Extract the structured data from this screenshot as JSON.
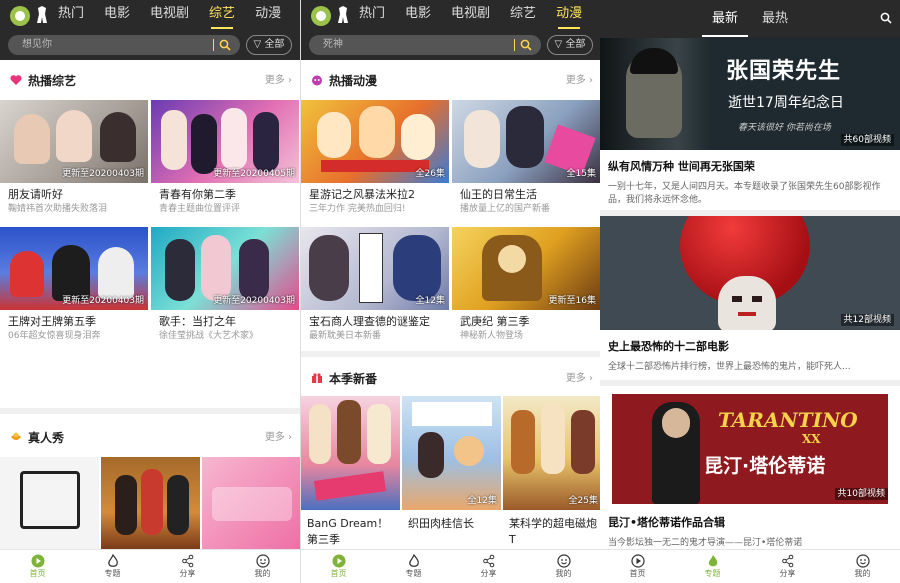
{
  "screen1": {
    "tabs": [
      {
        "label": "热门",
        "active": false
      },
      {
        "label": "电影",
        "active": false
      },
      {
        "label": "电视剧",
        "active": false
      },
      {
        "label": "综艺",
        "active": true
      },
      {
        "label": "动漫",
        "active": false
      }
    ],
    "search_placeholder": "想见你",
    "filter_label": "全部",
    "section1": {
      "title": "热播综艺",
      "more": "更多",
      "cards": [
        {
          "title": "朋友请听好",
          "subtitle": "鞠婧祎首次助播失败落泪",
          "badge": "更新至20200403期"
        },
        {
          "title": "青春有你第二季",
          "subtitle": "青春主题曲位置评评",
          "badge": "更新至20200405期"
        },
        {
          "title": "王牌对王牌第五季",
          "subtitle": "06年超女惊喜现身泪奔",
          "badge": "更新至20200403期"
        },
        {
          "title": "歌手：当打之年",
          "subtitle": "徐佳莹挑战《大艺术家》",
          "badge": "更新至20200403期"
        }
      ]
    },
    "section2": {
      "title": "真人秀",
      "more": "更多",
      "cards": [
        {
          "title": ""
        },
        {
          "title": ""
        },
        {
          "title": ""
        }
      ]
    }
  },
  "screen2": {
    "tabs": [
      {
        "label": "热门",
        "active": false
      },
      {
        "label": "电影",
        "active": false
      },
      {
        "label": "电视剧",
        "active": false
      },
      {
        "label": "综艺",
        "active": false
      },
      {
        "label": "动漫",
        "active": true
      }
    ],
    "search_placeholder": "死神",
    "filter_label": "全部",
    "section1": {
      "title": "热播动漫",
      "more": "更多",
      "cards": [
        {
          "title": "星游记之风暴法米拉2",
          "subtitle": "三年力作 完美热血回归!",
          "badge": "全26集"
        },
        {
          "title": "仙王的日常生活",
          "subtitle": "播放量上亿的国产新番",
          "badge": "全15集"
        },
        {
          "title": "宝石商人理查德的谜鉴定",
          "subtitle": "最新耽美日本新番",
          "badge": "全12集"
        },
        {
          "title": "武庚纪 第三季",
          "subtitle": "神秘新人物登场",
          "badge": "更新至16集"
        }
      ]
    },
    "section2": {
      "title": "本季新番",
      "more": "更多",
      "cards": [
        {
          "title": "BanG Dream！第三季",
          "badge": ""
        },
        {
          "title": "织田肉桂信长",
          "badge": "全12集"
        },
        {
          "title": "某科学的超电磁炮T",
          "badge": "全25集"
        }
      ]
    }
  },
  "screen3": {
    "tabs": [
      {
        "label": "最新",
        "active": true
      },
      {
        "label": "最热",
        "active": false
      }
    ],
    "topics": [
      {
        "image_text": "张国荣先生",
        "image_sub": "逝世17周年纪念日",
        "image_caption": "春天该很好  你若尚在场",
        "badge": "共60部视频",
        "title": "纵有风情万种 世间再无张国荣",
        "desc": "一别十七年，又是人间四月天。本专题收录了张国荣先生60部影视作品，我们将永远怀念他。"
      },
      {
        "badge": "共12部视频",
        "title": "史上最恐怖的十二部电影",
        "desc": "全球十二部恐怖片排行榜，世界上最恐怖的鬼片，能吓死人..."
      },
      {
        "image_text": "昆汀·塔伦蒂诺",
        "image_logo": "TARANTINO",
        "image_logo_sub": "XX",
        "badge": "共10部视频",
        "title": "昆汀•塔伦蒂诺作品合辑",
        "desc": "当今影坛独一无二的鬼才导演——昆汀•塔伦蒂诺"
      }
    ]
  },
  "bottom_nav": [
    {
      "label": "首页"
    },
    {
      "label": "专题"
    },
    {
      "label": "分享"
    },
    {
      "label": "我的"
    }
  ],
  "colors": {
    "accent": "#7fb33a",
    "tab_active": "#ffe45c",
    "topbar": "#2a2a2a"
  }
}
